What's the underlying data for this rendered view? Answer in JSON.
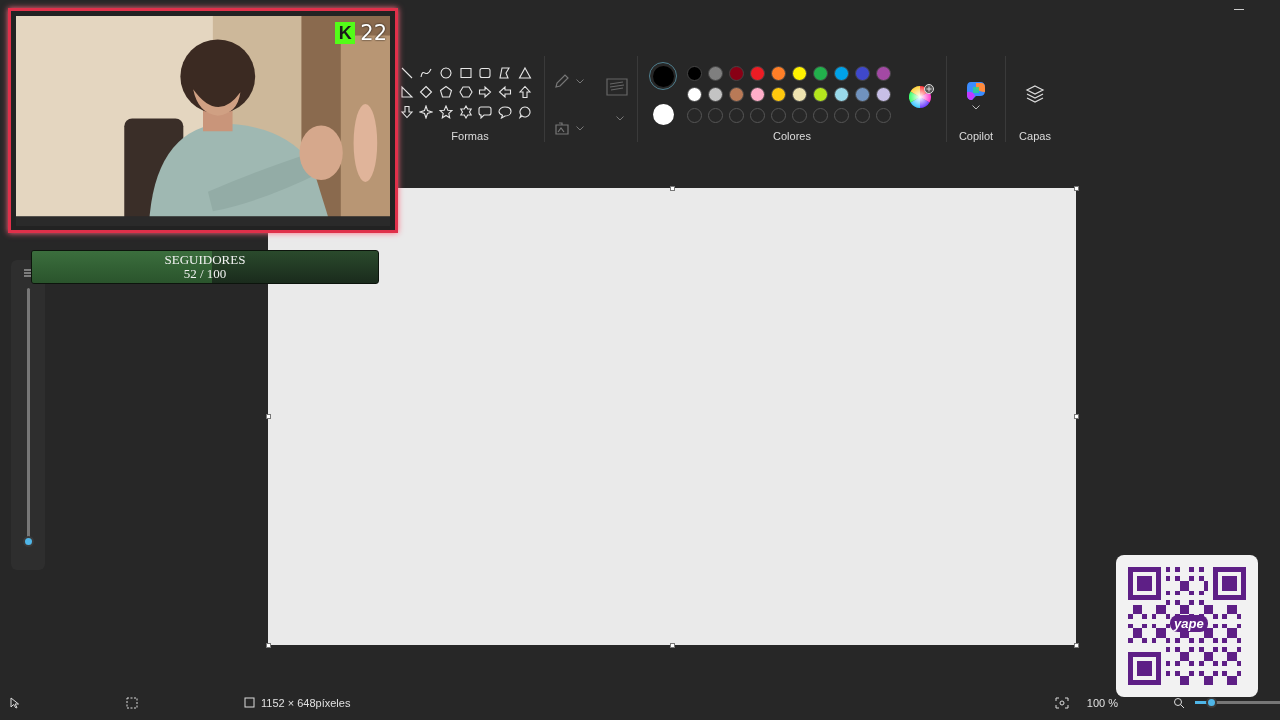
{
  "ribbon": {
    "shapes_label": "Formas",
    "colors": {
      "label": "Colores",
      "primary": {
        "color": "#000000",
        "selected": true
      },
      "secondary": {
        "color": "#ffffff",
        "selected": false
      },
      "palette": [
        {
          "color": "#000000"
        },
        {
          "color": "#7f7f7f"
        },
        {
          "color": "#880015"
        },
        {
          "color": "#ed1c24"
        },
        {
          "color": "#ff7f27"
        },
        {
          "color": "#fff200"
        },
        {
          "color": "#22b14c"
        },
        {
          "color": "#00a2e8"
        },
        {
          "color": "#3f48cc"
        },
        {
          "color": "#a349a4"
        },
        {
          "color": "#ffffff"
        },
        {
          "color": "#c3c3c3"
        },
        {
          "color": "#b97a57"
        },
        {
          "color": "#ffaec9"
        },
        {
          "color": "#ffc90e"
        },
        {
          "color": "#efe4b0"
        },
        {
          "color": "#b5e61d"
        },
        {
          "color": "#99d9ea"
        },
        {
          "color": "#7092be"
        },
        {
          "color": "#c8bfe7"
        }
      ]
    },
    "copilot_label": "Copilot",
    "layers_label": "Capas"
  },
  "brush_size": {
    "level": 0.02
  },
  "status_bar": {
    "canvas_size": "1152 × 648píxeles",
    "zoom": "100 %",
    "zoom_slider": {
      "level": 0.2
    }
  },
  "stream_overlay": {
    "viewer_logo": "K",
    "viewer_count": "22",
    "followers_goal": {
      "label": "SEGUIDORES",
      "count": "52 / 100",
      "level": 0.52
    },
    "qr_label": "yape"
  }
}
